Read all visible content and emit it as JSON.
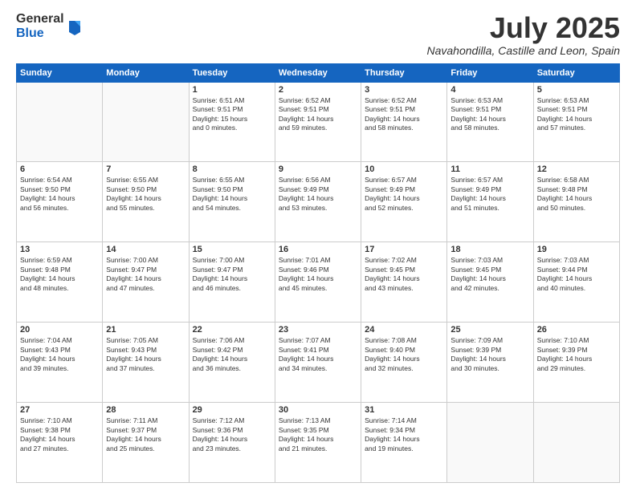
{
  "logo": {
    "general": "General",
    "blue": "Blue"
  },
  "header": {
    "month": "July 2025",
    "location": "Navahondilla, Castille and Leon, Spain"
  },
  "weekdays": [
    "Sunday",
    "Monday",
    "Tuesday",
    "Wednesday",
    "Thursday",
    "Friday",
    "Saturday"
  ],
  "weeks": [
    [
      {
        "day": "",
        "info": ""
      },
      {
        "day": "",
        "info": ""
      },
      {
        "day": "1",
        "info": "Sunrise: 6:51 AM\nSunset: 9:51 PM\nDaylight: 15 hours\nand 0 minutes."
      },
      {
        "day": "2",
        "info": "Sunrise: 6:52 AM\nSunset: 9:51 PM\nDaylight: 14 hours\nand 59 minutes."
      },
      {
        "day": "3",
        "info": "Sunrise: 6:52 AM\nSunset: 9:51 PM\nDaylight: 14 hours\nand 58 minutes."
      },
      {
        "day": "4",
        "info": "Sunrise: 6:53 AM\nSunset: 9:51 PM\nDaylight: 14 hours\nand 58 minutes."
      },
      {
        "day": "5",
        "info": "Sunrise: 6:53 AM\nSunset: 9:51 PM\nDaylight: 14 hours\nand 57 minutes."
      }
    ],
    [
      {
        "day": "6",
        "info": "Sunrise: 6:54 AM\nSunset: 9:50 PM\nDaylight: 14 hours\nand 56 minutes."
      },
      {
        "day": "7",
        "info": "Sunrise: 6:55 AM\nSunset: 9:50 PM\nDaylight: 14 hours\nand 55 minutes."
      },
      {
        "day": "8",
        "info": "Sunrise: 6:55 AM\nSunset: 9:50 PM\nDaylight: 14 hours\nand 54 minutes."
      },
      {
        "day": "9",
        "info": "Sunrise: 6:56 AM\nSunset: 9:49 PM\nDaylight: 14 hours\nand 53 minutes."
      },
      {
        "day": "10",
        "info": "Sunrise: 6:57 AM\nSunset: 9:49 PM\nDaylight: 14 hours\nand 52 minutes."
      },
      {
        "day": "11",
        "info": "Sunrise: 6:57 AM\nSunset: 9:49 PM\nDaylight: 14 hours\nand 51 minutes."
      },
      {
        "day": "12",
        "info": "Sunrise: 6:58 AM\nSunset: 9:48 PM\nDaylight: 14 hours\nand 50 minutes."
      }
    ],
    [
      {
        "day": "13",
        "info": "Sunrise: 6:59 AM\nSunset: 9:48 PM\nDaylight: 14 hours\nand 48 minutes."
      },
      {
        "day": "14",
        "info": "Sunrise: 7:00 AM\nSunset: 9:47 PM\nDaylight: 14 hours\nand 47 minutes."
      },
      {
        "day": "15",
        "info": "Sunrise: 7:00 AM\nSunset: 9:47 PM\nDaylight: 14 hours\nand 46 minutes."
      },
      {
        "day": "16",
        "info": "Sunrise: 7:01 AM\nSunset: 9:46 PM\nDaylight: 14 hours\nand 45 minutes."
      },
      {
        "day": "17",
        "info": "Sunrise: 7:02 AM\nSunset: 9:45 PM\nDaylight: 14 hours\nand 43 minutes."
      },
      {
        "day": "18",
        "info": "Sunrise: 7:03 AM\nSunset: 9:45 PM\nDaylight: 14 hours\nand 42 minutes."
      },
      {
        "day": "19",
        "info": "Sunrise: 7:03 AM\nSunset: 9:44 PM\nDaylight: 14 hours\nand 40 minutes."
      }
    ],
    [
      {
        "day": "20",
        "info": "Sunrise: 7:04 AM\nSunset: 9:43 PM\nDaylight: 14 hours\nand 39 minutes."
      },
      {
        "day": "21",
        "info": "Sunrise: 7:05 AM\nSunset: 9:43 PM\nDaylight: 14 hours\nand 37 minutes."
      },
      {
        "day": "22",
        "info": "Sunrise: 7:06 AM\nSunset: 9:42 PM\nDaylight: 14 hours\nand 36 minutes."
      },
      {
        "day": "23",
        "info": "Sunrise: 7:07 AM\nSunset: 9:41 PM\nDaylight: 14 hours\nand 34 minutes."
      },
      {
        "day": "24",
        "info": "Sunrise: 7:08 AM\nSunset: 9:40 PM\nDaylight: 14 hours\nand 32 minutes."
      },
      {
        "day": "25",
        "info": "Sunrise: 7:09 AM\nSunset: 9:39 PM\nDaylight: 14 hours\nand 30 minutes."
      },
      {
        "day": "26",
        "info": "Sunrise: 7:10 AM\nSunset: 9:39 PM\nDaylight: 14 hours\nand 29 minutes."
      }
    ],
    [
      {
        "day": "27",
        "info": "Sunrise: 7:10 AM\nSunset: 9:38 PM\nDaylight: 14 hours\nand 27 minutes."
      },
      {
        "day": "28",
        "info": "Sunrise: 7:11 AM\nSunset: 9:37 PM\nDaylight: 14 hours\nand 25 minutes."
      },
      {
        "day": "29",
        "info": "Sunrise: 7:12 AM\nSunset: 9:36 PM\nDaylight: 14 hours\nand 23 minutes."
      },
      {
        "day": "30",
        "info": "Sunrise: 7:13 AM\nSunset: 9:35 PM\nDaylight: 14 hours\nand 21 minutes."
      },
      {
        "day": "31",
        "info": "Sunrise: 7:14 AM\nSunset: 9:34 PM\nDaylight: 14 hours\nand 19 minutes."
      },
      {
        "day": "",
        "info": ""
      },
      {
        "day": "",
        "info": ""
      }
    ]
  ]
}
